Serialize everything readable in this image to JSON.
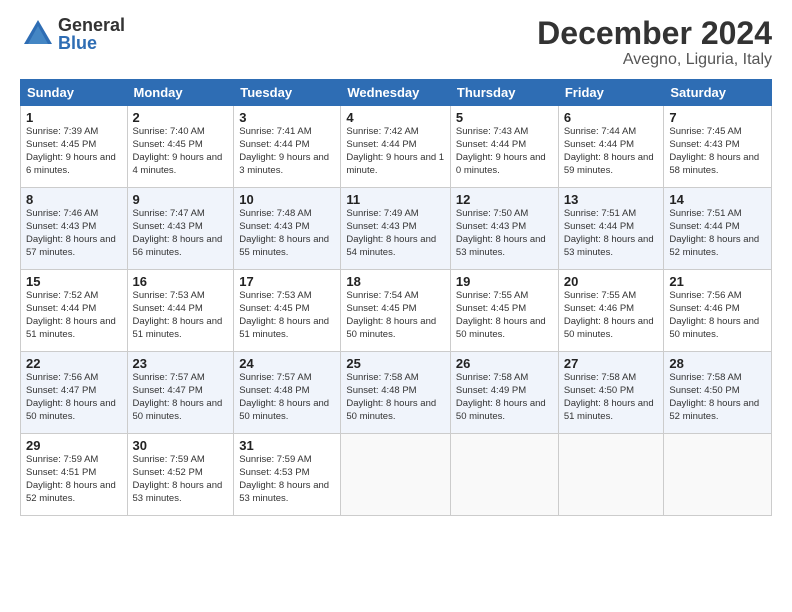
{
  "logo": {
    "general": "General",
    "blue": "Blue"
  },
  "header": {
    "month": "December 2024",
    "location": "Avegno, Liguria, Italy"
  },
  "days_of_week": [
    "Sunday",
    "Monday",
    "Tuesday",
    "Wednesday",
    "Thursday",
    "Friday",
    "Saturday"
  ],
  "weeks": [
    [
      {
        "day": "1",
        "sunrise": "7:39 AM",
        "sunset": "4:45 PM",
        "daylight": "9 hours and 6 minutes."
      },
      {
        "day": "2",
        "sunrise": "7:40 AM",
        "sunset": "4:45 PM",
        "daylight": "9 hours and 4 minutes."
      },
      {
        "day": "3",
        "sunrise": "7:41 AM",
        "sunset": "4:44 PM",
        "daylight": "9 hours and 3 minutes."
      },
      {
        "day": "4",
        "sunrise": "7:42 AM",
        "sunset": "4:44 PM",
        "daylight": "9 hours and 1 minute."
      },
      {
        "day": "5",
        "sunrise": "7:43 AM",
        "sunset": "4:44 PM",
        "daylight": "9 hours and 0 minutes."
      },
      {
        "day": "6",
        "sunrise": "7:44 AM",
        "sunset": "4:44 PM",
        "daylight": "8 hours and 59 minutes."
      },
      {
        "day": "7",
        "sunrise": "7:45 AM",
        "sunset": "4:43 PM",
        "daylight": "8 hours and 58 minutes."
      }
    ],
    [
      {
        "day": "8",
        "sunrise": "7:46 AM",
        "sunset": "4:43 PM",
        "daylight": "8 hours and 57 minutes."
      },
      {
        "day": "9",
        "sunrise": "7:47 AM",
        "sunset": "4:43 PM",
        "daylight": "8 hours and 56 minutes."
      },
      {
        "day": "10",
        "sunrise": "7:48 AM",
        "sunset": "4:43 PM",
        "daylight": "8 hours and 55 minutes."
      },
      {
        "day": "11",
        "sunrise": "7:49 AM",
        "sunset": "4:43 PM",
        "daylight": "8 hours and 54 minutes."
      },
      {
        "day": "12",
        "sunrise": "7:50 AM",
        "sunset": "4:43 PM",
        "daylight": "8 hours and 53 minutes."
      },
      {
        "day": "13",
        "sunrise": "7:51 AM",
        "sunset": "4:44 PM",
        "daylight": "8 hours and 53 minutes."
      },
      {
        "day": "14",
        "sunrise": "7:51 AM",
        "sunset": "4:44 PM",
        "daylight": "8 hours and 52 minutes."
      }
    ],
    [
      {
        "day": "15",
        "sunrise": "7:52 AM",
        "sunset": "4:44 PM",
        "daylight": "8 hours and 51 minutes."
      },
      {
        "day": "16",
        "sunrise": "7:53 AM",
        "sunset": "4:44 PM",
        "daylight": "8 hours and 51 minutes."
      },
      {
        "day": "17",
        "sunrise": "7:53 AM",
        "sunset": "4:45 PM",
        "daylight": "8 hours and 51 minutes."
      },
      {
        "day": "18",
        "sunrise": "7:54 AM",
        "sunset": "4:45 PM",
        "daylight": "8 hours and 50 minutes."
      },
      {
        "day": "19",
        "sunrise": "7:55 AM",
        "sunset": "4:45 PM",
        "daylight": "8 hours and 50 minutes."
      },
      {
        "day": "20",
        "sunrise": "7:55 AM",
        "sunset": "4:46 PM",
        "daylight": "8 hours and 50 minutes."
      },
      {
        "day": "21",
        "sunrise": "7:56 AM",
        "sunset": "4:46 PM",
        "daylight": "8 hours and 50 minutes."
      }
    ],
    [
      {
        "day": "22",
        "sunrise": "7:56 AM",
        "sunset": "4:47 PM",
        "daylight": "8 hours and 50 minutes."
      },
      {
        "day": "23",
        "sunrise": "7:57 AM",
        "sunset": "4:47 PM",
        "daylight": "8 hours and 50 minutes."
      },
      {
        "day": "24",
        "sunrise": "7:57 AM",
        "sunset": "4:48 PM",
        "daylight": "8 hours and 50 minutes."
      },
      {
        "day": "25",
        "sunrise": "7:58 AM",
        "sunset": "4:48 PM",
        "daylight": "8 hours and 50 minutes."
      },
      {
        "day": "26",
        "sunrise": "7:58 AM",
        "sunset": "4:49 PM",
        "daylight": "8 hours and 50 minutes."
      },
      {
        "day": "27",
        "sunrise": "7:58 AM",
        "sunset": "4:50 PM",
        "daylight": "8 hours and 51 minutes."
      },
      {
        "day": "28",
        "sunrise": "7:58 AM",
        "sunset": "4:50 PM",
        "daylight": "8 hours and 52 minutes."
      }
    ],
    [
      {
        "day": "29",
        "sunrise": "7:59 AM",
        "sunset": "4:51 PM",
        "daylight": "8 hours and 52 minutes."
      },
      {
        "day": "30",
        "sunrise": "7:59 AM",
        "sunset": "4:52 PM",
        "daylight": "8 hours and 53 minutes."
      },
      {
        "day": "31",
        "sunrise": "7:59 AM",
        "sunset": "4:53 PM",
        "daylight": "8 hours and 53 minutes."
      },
      null,
      null,
      null,
      null
    ]
  ],
  "labels": {
    "sunrise": "Sunrise:",
    "sunset": "Sunset:",
    "daylight": "Daylight:"
  }
}
